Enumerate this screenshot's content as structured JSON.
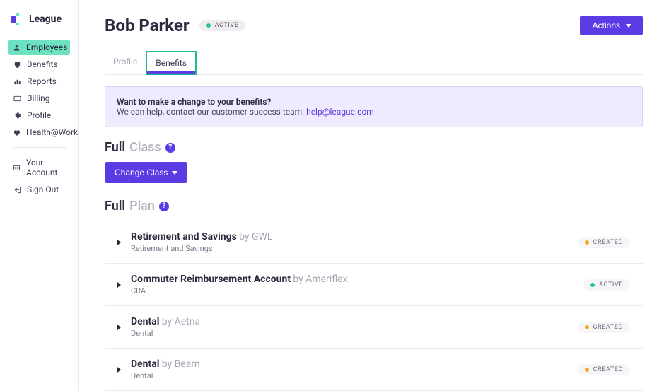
{
  "brand": {
    "name": "League"
  },
  "sidebar": {
    "nav": [
      {
        "label": "Employees",
        "icon": "user"
      },
      {
        "label": "Benefits",
        "icon": "shield"
      },
      {
        "label": "Reports",
        "icon": "chart"
      },
      {
        "label": "Billing",
        "icon": "card"
      },
      {
        "label": "Profile",
        "icon": "gear"
      },
      {
        "label": "Health@Work",
        "icon": "heart"
      }
    ],
    "account": [
      {
        "label": "Your Account",
        "icon": "id"
      },
      {
        "label": "Sign Out",
        "icon": "signout"
      }
    ]
  },
  "header": {
    "title": "Bob Parker",
    "status": "ACTIVE",
    "actions_label": "Actions"
  },
  "tabs": [
    {
      "label": "Profile"
    },
    {
      "label": "Benefits"
    }
  ],
  "notice": {
    "heading": "Want to make a change to your benefits?",
    "body": "We can help, contact our customer success team: ",
    "link_text": "help@league.com"
  },
  "class_section": {
    "word1": "Full",
    "word2": "Class",
    "button": "Change Class"
  },
  "plan_section": {
    "word1": "Full",
    "word2": "Plan"
  },
  "plans": [
    {
      "name": "Retirement and Savings",
      "provider": "by GWL",
      "sub": "Retirement and Savings",
      "status": "CREATED",
      "status_color": "orange"
    },
    {
      "name": "Commuter Reimbursement Account",
      "provider": "by Ameriflex",
      "sub": "CRA",
      "status": "ACTIVE",
      "status_color": "green"
    },
    {
      "name": "Dental",
      "provider": "by Aetna",
      "sub": "Dental",
      "status": "CREATED",
      "status_color": "orange"
    },
    {
      "name": "Dental",
      "provider": "by Beam",
      "sub": "Dental",
      "status": "CREATED",
      "status_color": "orange"
    }
  ]
}
